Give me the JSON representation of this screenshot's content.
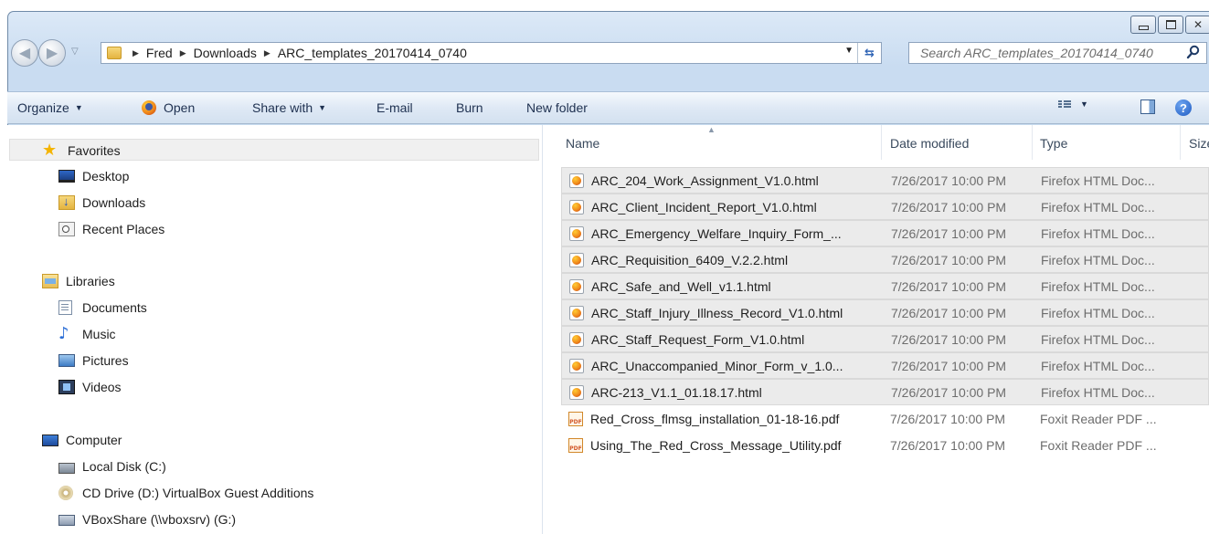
{
  "breadcrumb": [
    "Fred",
    "Downloads",
    "ARC_templates_20170414_0740"
  ],
  "search": {
    "placeholder": "Search ARC_templates_20170414_0740"
  },
  "toolbar": {
    "organize": "Organize",
    "open": "Open",
    "share_with": "Share with",
    "email": "E-mail",
    "burn": "Burn",
    "new_folder": "New folder"
  },
  "sidebar": {
    "favorites": {
      "label": "Favorites",
      "items": [
        {
          "label": "Desktop",
          "icon": "desktop-icon"
        },
        {
          "label": "Downloads",
          "icon": "downloads-folder-icon"
        },
        {
          "label": "Recent Places",
          "icon": "recent-places-icon"
        }
      ]
    },
    "libraries": {
      "label": "Libraries",
      "items": [
        {
          "label": "Documents",
          "icon": "documents-icon"
        },
        {
          "label": "Music",
          "icon": "music-icon"
        },
        {
          "label": "Pictures",
          "icon": "pictures-icon"
        },
        {
          "label": "Videos",
          "icon": "videos-icon"
        }
      ]
    },
    "computer": {
      "label": "Computer",
      "items": [
        {
          "label": "Local Disk (C:)",
          "icon": "disk-icon"
        },
        {
          "label": "CD Drive (D:) VirtualBox Guest Additions",
          "icon": "cd-drive-icon"
        },
        {
          "label": "VBoxShare (\\\\vboxsrv) (G:)",
          "icon": "network-drive-icon"
        }
      ]
    }
  },
  "columns": {
    "name": "Name",
    "date": "Date modified",
    "type": "Type",
    "size": "Size"
  },
  "files": [
    {
      "name": "ARC_204_Work_Assignment_V1.0.html",
      "date": "7/26/2017 10:00 PM",
      "type": "Firefox HTML Doc...",
      "kind": "html",
      "selected": true
    },
    {
      "name": "ARC_Client_Incident_Report_V1.0.html",
      "date": "7/26/2017 10:00 PM",
      "type": "Firefox HTML Doc...",
      "kind": "html",
      "selected": true
    },
    {
      "name": "ARC_Emergency_Welfare_Inquiry_Form_...",
      "date": "7/26/2017 10:00 PM",
      "type": "Firefox HTML Doc...",
      "kind": "html",
      "selected": true
    },
    {
      "name": "ARC_Requisition_6409_V.2.2.html",
      "date": "7/26/2017 10:00 PM",
      "type": "Firefox HTML Doc...",
      "kind": "html",
      "selected": true
    },
    {
      "name": "ARC_Safe_and_Well_v1.1.html",
      "date": "7/26/2017 10:00 PM",
      "type": "Firefox HTML Doc...",
      "kind": "html",
      "selected": true
    },
    {
      "name": "ARC_Staff_Injury_Illness_Record_V1.0.html",
      "date": "7/26/2017 10:00 PM",
      "type": "Firefox HTML Doc...",
      "kind": "html",
      "selected": true
    },
    {
      "name": "ARC_Staff_Request_Form_V1.0.html",
      "date": "7/26/2017 10:00 PM",
      "type": "Firefox HTML Doc...",
      "kind": "html",
      "selected": true
    },
    {
      "name": "ARC_Unaccompanied_Minor_Form_v_1.0...",
      "date": "7/26/2017 10:00 PM",
      "type": "Firefox HTML Doc...",
      "kind": "html",
      "selected": true
    },
    {
      "name": "ARC-213_V1.1_01.18.17.html",
      "date": "7/26/2017 10:00 PM",
      "type": "Firefox HTML Doc...",
      "kind": "html",
      "selected": true
    },
    {
      "name": "Red_Cross_flmsg_installation_01-18-16.pdf",
      "date": "7/26/2017 10:00 PM",
      "type": "Foxit Reader PDF ...",
      "kind": "pdf",
      "selected": false
    },
    {
      "name": "Using_The_Red_Cross_Message_Utility.pdf",
      "date": "7/26/2017 10:00 PM",
      "type": "Foxit Reader PDF ...",
      "kind": "pdf",
      "selected": false
    }
  ]
}
